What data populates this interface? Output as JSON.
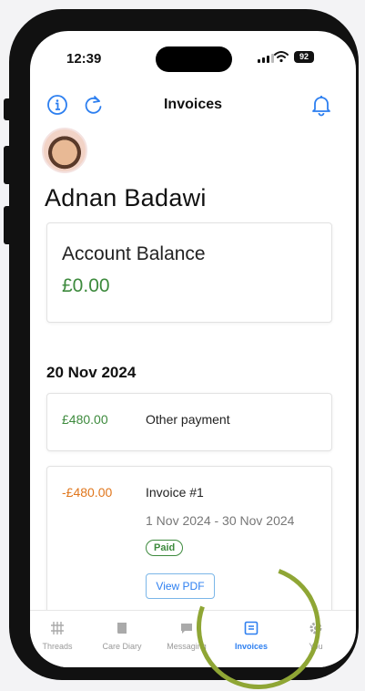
{
  "status_bar": {
    "time": "12:39",
    "battery": "92"
  },
  "header": {
    "title": "Invoices",
    "info_icon": "info-icon",
    "refresh_icon": "refresh-icon",
    "bell_icon": "bell-icon"
  },
  "profile": {
    "name": "Adnan Badawi"
  },
  "balance": {
    "label": "Account Balance",
    "value": "£0.00"
  },
  "transactions_date": "20 Nov 2024",
  "transactions": [
    {
      "amount": "£480.00",
      "description": "Other payment"
    },
    {
      "amount": "-£480.00",
      "description": "Invoice #1",
      "period": "1 Nov 2024 - 30 Nov 2024",
      "status": "Paid",
      "action": "View PDF"
    }
  ],
  "tabs": [
    {
      "label": "Threads",
      "icon": "grid-icon"
    },
    {
      "label": "Care Diary",
      "icon": "book-icon"
    },
    {
      "label": "Messaging",
      "icon": "chat-icon"
    },
    {
      "label": "Invoices",
      "icon": "invoice-icon",
      "active": true
    },
    {
      "label": "You",
      "icon": "gear-icon"
    }
  ],
  "colors": {
    "accent": "#2d7ff0",
    "positive": "#3d8a3d",
    "negative": "#e0761c",
    "highlight_ring": "#8fa635"
  }
}
